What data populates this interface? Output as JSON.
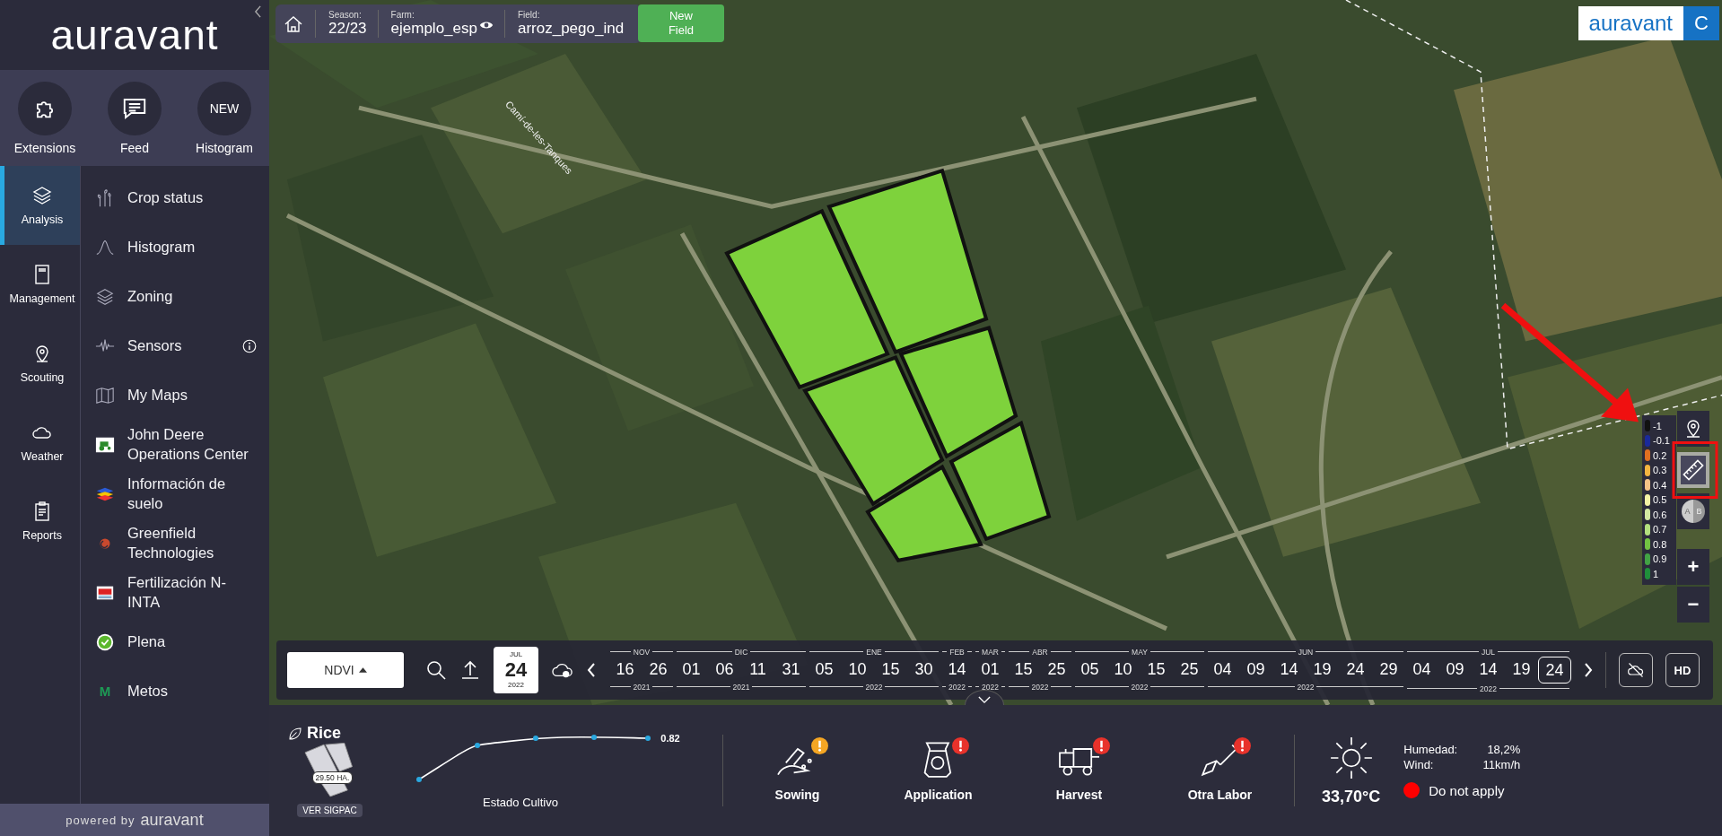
{
  "sidebar": {
    "logo": "auravant",
    "shortcuts": [
      {
        "label": "Extensions",
        "kind": "puzzle"
      },
      {
        "label": "Feed",
        "kind": "chat"
      },
      {
        "label": "Histogram",
        "kind": "badge",
        "badge": "NEW"
      }
    ],
    "nav": [
      {
        "label": "Analysis",
        "kind": "layers",
        "selected": true
      },
      {
        "label": "Management",
        "kind": "book",
        "selected": false
      },
      {
        "label": "Scouting",
        "kind": "pin",
        "selected": false
      },
      {
        "label": "Weather",
        "kind": "cloud",
        "selected": false
      },
      {
        "label": "Reports",
        "kind": "clipboard",
        "selected": false
      }
    ],
    "items": [
      {
        "label": "Crop status",
        "kind": "sprout",
        "info": false
      },
      {
        "label": "Histogram",
        "kind": "curve",
        "info": false
      },
      {
        "label": "Zoning",
        "kind": "layers",
        "info": false
      },
      {
        "label": "Sensors",
        "kind": "wave",
        "info": true
      },
      {
        "label": "My Maps",
        "kind": "map",
        "info": false
      },
      {
        "label": "John Deere Operations Center",
        "kind": "tractor",
        "info": false
      },
      {
        "label": "Información de suelo",
        "kind": "stack",
        "info": false
      },
      {
        "label": "Greenfield Technologies",
        "kind": "flame",
        "info": false
      },
      {
        "label": "Fertilización N-INTA",
        "kind": "flag",
        "info": false
      },
      {
        "label": "Plena",
        "kind": "check",
        "info": false
      },
      {
        "label": "Metos",
        "kind": "letter",
        "letter": "M",
        "info": false
      }
    ],
    "footer": {
      "prefix": "powered by",
      "brand": "auravant"
    }
  },
  "topbar": {
    "season_label": "Season:",
    "season": "22/23",
    "farm_label": "Farm:",
    "farm": "ejemplo_esp",
    "field_label": "Field:",
    "field": "arroz_pego_ind",
    "new_button": "New Field"
  },
  "brand": {
    "logo": "auravant",
    "initial": "C"
  },
  "map": {
    "road_label": "Camí-de-les-Tanques"
  },
  "legend": [
    {
      "label": "-1",
      "color": "#111111"
    },
    {
      "label": "-0.1",
      "color": "#1a2a9a"
    },
    {
      "label": "0.2",
      "color": "#e07020"
    },
    {
      "label": "0.3",
      "color": "#f2b440"
    },
    {
      "label": "0.4",
      "color": "#f6c486"
    },
    {
      "label": "0.5",
      "color": "#f2f2a4"
    },
    {
      "label": "0.6",
      "color": "#d2e8a2"
    },
    {
      "label": "0.7",
      "color": "#b2e07e"
    },
    {
      "label": "0.8",
      "color": "#72c242"
    },
    {
      "label": "0.9",
      "color": "#42a244"
    },
    {
      "label": "1",
      "color": "#1f8f3a"
    }
  ],
  "map_tools": [
    {
      "kind": "pin",
      "selected": false
    },
    {
      "kind": "ruler",
      "selected": true
    },
    {
      "kind": "compare",
      "selected": false,
      "label_a": "A",
      "label_b": "B"
    }
  ],
  "zoom": {
    "in": "+",
    "out": "−"
  },
  "timeline": {
    "index": "NDVI",
    "date": {
      "month": "JUL",
      "day": "24",
      "year": "2022"
    },
    "groups": [
      {
        "month": "NOV",
        "year": "2021",
        "dates": [
          {
            "label": "16",
            "selected": false
          },
          {
            "label": "26",
            "selected": false
          }
        ]
      },
      {
        "month": "DIC",
        "year": "2021",
        "dates": [
          {
            "label": "01",
            "selected": false
          },
          {
            "label": "06",
            "selected": false
          },
          {
            "label": "11",
            "selected": false
          },
          {
            "label": "31",
            "selected": false
          }
        ]
      },
      {
        "month": "ENE",
        "year": "2022",
        "dates": [
          {
            "label": "05",
            "selected": false
          },
          {
            "label": "10",
            "selected": false
          },
          {
            "label": "15",
            "selected": false
          },
          {
            "label": "30",
            "selected": false
          }
        ]
      },
      {
        "month": "FEB",
        "year": "2022",
        "dates": [
          {
            "label": "14",
            "selected": false
          }
        ]
      },
      {
        "month": "MAR",
        "year": "2022",
        "dates": [
          {
            "label": "01",
            "selected": false
          }
        ]
      },
      {
        "month": "ABR",
        "year": "2022",
        "dates": [
          {
            "label": "15",
            "selected": false
          },
          {
            "label": "25",
            "selected": false
          }
        ]
      },
      {
        "month": "MAY",
        "year": "2022",
        "dates": [
          {
            "label": "05",
            "selected": false
          },
          {
            "label": "10",
            "selected": false
          },
          {
            "label": "15",
            "selected": false
          },
          {
            "label": "25",
            "selected": false
          }
        ]
      },
      {
        "month": "JUN",
        "year": "2022",
        "dates": [
          {
            "label": "04",
            "selected": false
          },
          {
            "label": "09",
            "selected": false
          },
          {
            "label": "14",
            "selected": false
          },
          {
            "label": "19",
            "selected": false
          },
          {
            "label": "24",
            "selected": false
          },
          {
            "label": "29",
            "selected": false
          }
        ]
      },
      {
        "month": "JUL",
        "year": "2022",
        "dates": [
          {
            "label": "04",
            "selected": false
          },
          {
            "label": "09",
            "selected": false
          },
          {
            "label": "14",
            "selected": false
          },
          {
            "label": "19",
            "selected": false
          },
          {
            "label": "24",
            "selected": true
          }
        ]
      }
    ],
    "hd": "HD"
  },
  "bottom": {
    "crop": "Rice",
    "area": "29.50 HA.",
    "sigpac": "VER SIGPAC",
    "index_value": "0.82",
    "index_label": "Estado Cultivo",
    "tasks": [
      {
        "label": "Sowing",
        "kind": "sowing",
        "color": "#f5a623"
      },
      {
        "label": "Application",
        "kind": "sack",
        "color": "#e8322b"
      },
      {
        "label": "Harvest",
        "kind": "combine",
        "color": "#e8322b"
      },
      {
        "label": "Otra Labor",
        "kind": "shovel",
        "color": "#e8322b"
      }
    ],
    "weather": {
      "temperature": "33,70°C",
      "rows": [
        {
          "label": "Humedad:",
          "value": "18,2%"
        },
        {
          "label": "Wind:",
          "value": "11km/h"
        }
      ],
      "advice": "Do not apply",
      "color": "#ff0000"
    }
  }
}
